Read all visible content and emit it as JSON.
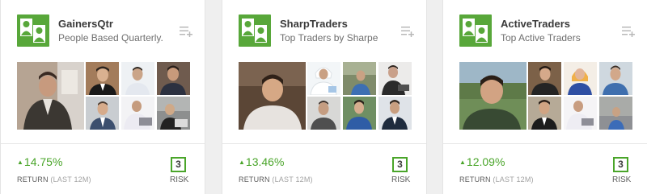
{
  "colors": {
    "accent": "#4aa52a",
    "logo_bg": "#58a73a",
    "page_bg": "#efefef"
  },
  "icons": {
    "logo": "people-icon",
    "add": "add-to-list-icon",
    "gain": "up-triangle-icon"
  },
  "cards": [
    {
      "title": "GainersQtr",
      "subtitle": "People Based Quarterly...",
      "gain": "14.75%",
      "return_label": "RETURN",
      "return_period": "(LAST 12M)",
      "risk": "3",
      "risk_label": "RISK"
    },
    {
      "title": "SharpTraders",
      "subtitle": "Top Traders by Sharpe",
      "gain": "13.46%",
      "return_label": "RETURN",
      "return_period": "(LAST 12M)",
      "risk": "3",
      "risk_label": "RISK"
    },
    {
      "title": "ActiveTraders",
      "subtitle": "Top Active Traders",
      "gain": "12.09%",
      "return_label": "RETURN",
      "return_period": "(LAST 12M)",
      "risk": "3",
      "risk_label": "RISK"
    }
  ]
}
